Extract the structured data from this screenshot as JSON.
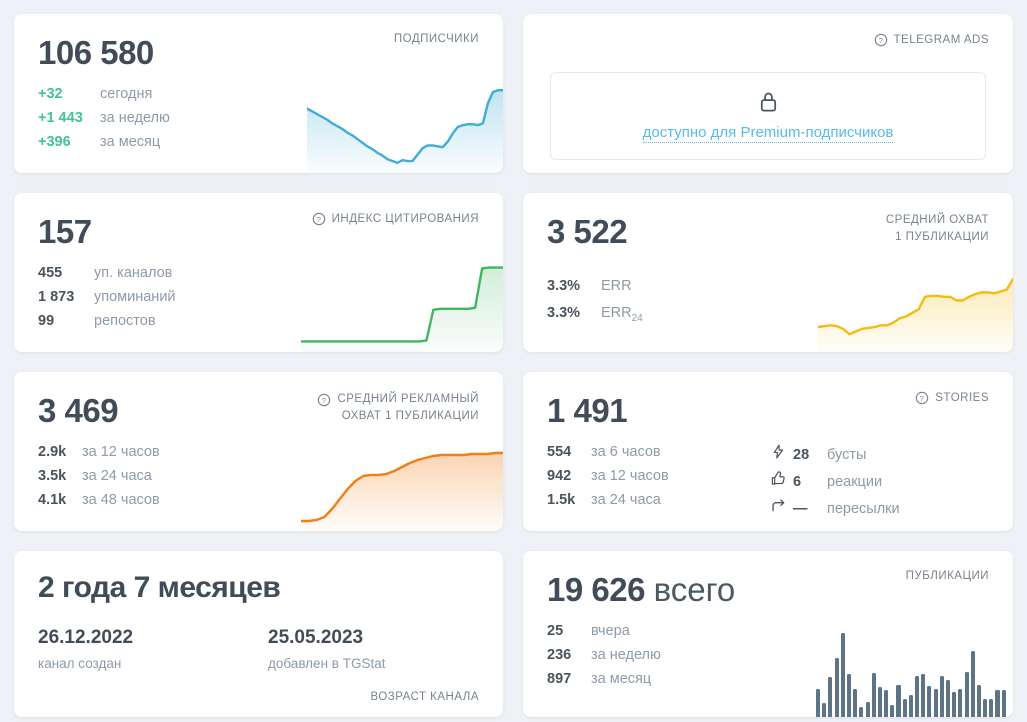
{
  "accent_colors": {
    "positive_green": "#3fc492",
    "link_blue": "#58bce6",
    "big_number": "#414c58",
    "muted_label": "#8e9aa9",
    "card_title": "#78838f"
  },
  "cards": {
    "subscribers": {
      "title": "ПОДПИСЧИКИ",
      "value": "106 580",
      "stats": [
        {
          "value": "+32",
          "label": "сегодня"
        },
        {
          "value": "+1 443",
          "label": "за неделю"
        },
        {
          "value": "+396",
          "label": "за месяц"
        }
      ]
    },
    "telegram_ads": {
      "title": "TELEGRAM ADS",
      "locked_link": "доступно для Premium-подписчиков"
    },
    "citation_index": {
      "title": "ИНДЕКС ЦИТИРОВАНИЯ",
      "value": "157",
      "stats": [
        {
          "value": "455",
          "label": "уп. каналов"
        },
        {
          "value": "1 873",
          "label": "упоминаний"
        },
        {
          "value": "99",
          "label": "репостов"
        }
      ]
    },
    "avg_reach": {
      "title_line1": "СРЕДНИЙ ОХВАТ",
      "title_line2": "1 ПУБЛИКАЦИИ",
      "value": "3 522",
      "stats": [
        {
          "value": "3.3%",
          "label": "ERR",
          "sub": ""
        },
        {
          "value": "3.3%",
          "label": "ERR",
          "sub": "24"
        }
      ]
    },
    "avg_ad_reach": {
      "title_line1": "СРЕДНИЙ РЕКЛАМНЫЙ",
      "title_line2": "ОХВАТ 1 ПУБЛИКАЦИИ",
      "value": "3 469",
      "stats": [
        {
          "value": "2.9k",
          "label": "за 12 часов"
        },
        {
          "value": "3.5k",
          "label": "за 24 часа"
        },
        {
          "value": "4.1k",
          "label": "за 48 часов"
        }
      ]
    },
    "stories": {
      "title": "STORIES",
      "value": "1 491",
      "stats_left": [
        {
          "value": "554",
          "label": "за 6 часов"
        },
        {
          "value": "942",
          "label": "за 12 часов"
        },
        {
          "value": "1.5k",
          "label": "за 24 часа"
        }
      ],
      "stats_right": [
        {
          "icon": "boost-icon",
          "value": "28",
          "label": "бусты"
        },
        {
          "icon": "like-icon",
          "value": "6",
          "label": "реакции"
        },
        {
          "icon": "forward-icon",
          "value": "—",
          "label": "пересылки"
        }
      ]
    },
    "channel_age": {
      "value": "2 года 7 месяцев",
      "footer": "ВОЗРАСТ КАНАЛА",
      "dates": [
        {
          "value": "26.12.2022",
          "label": "канал создан"
        },
        {
          "value": "25.05.2023",
          "label": "добавлен в TGStat"
        }
      ]
    },
    "publications": {
      "title": "ПУБЛИКАЦИИ",
      "value": "19 626",
      "value_suffix": "всего",
      "stats": [
        {
          "value": "25",
          "label": "вчера"
        },
        {
          "value": "236",
          "label": "за неделю"
        },
        {
          "value": "897",
          "label": "за месяц"
        }
      ]
    }
  },
  "chart_data": [
    {
      "id": "subscribers-sparkline",
      "type": "area",
      "color": "#3fadd5",
      "fill_opacity": 0.33,
      "values": [
        70,
        67,
        64,
        61,
        58,
        54,
        51,
        48,
        44,
        41,
        37,
        33,
        29,
        26,
        22,
        19,
        15,
        13,
        11,
        14,
        13,
        13,
        20,
        27,
        30,
        30,
        29,
        28,
        34,
        43,
        50,
        52,
        53,
        53,
        52,
        54,
        76,
        88,
        90,
        90
      ]
    },
    {
      "id": "citation-sparkline",
      "type": "area",
      "color": "#43b560",
      "fill_opacity": 0.24,
      "values": [
        11,
        11,
        11,
        11,
        11,
        11,
        11,
        11,
        11,
        11,
        11,
        11,
        11,
        11,
        11,
        11,
        11,
        11,
        12,
        44,
        45,
        45,
        45,
        45,
        45,
        46,
        87,
        88,
        88,
        88
      ]
    },
    {
      "id": "avg-reach-sparkline",
      "type": "area",
      "color": "#f6ba10",
      "fill_opacity": 0.3,
      "values": [
        28,
        29,
        30,
        29,
        26,
        20,
        23,
        26,
        27,
        28,
        30,
        30,
        33,
        38,
        40,
        44,
        48,
        62,
        63,
        63,
        62,
        62,
        58,
        58,
        62,
        65,
        67,
        67,
        66,
        68,
        70,
        82
      ]
    },
    {
      "id": "ad-reach-sparkline",
      "type": "area",
      "color": "#f07f16",
      "fill_opacity": 0.33,
      "values": [
        10,
        10,
        11,
        14,
        22,
        32,
        42,
        50,
        55,
        56,
        56,
        57,
        60,
        64,
        68,
        71,
        73,
        75,
        76,
        76,
        76,
        76,
        77,
        77,
        77,
        78,
        78
      ]
    },
    {
      "id": "publications-bars",
      "type": "bar",
      "color": "#5d7386",
      "values": [
        30,
        15,
        42,
        62,
        88,
        45,
        30,
        11,
        16,
        46,
        32,
        28,
        13,
        34,
        19,
        23,
        43,
        45,
        33,
        29,
        43,
        39,
        26,
        29,
        47,
        70,
        34,
        19,
        19,
        28,
        28
      ]
    }
  ]
}
